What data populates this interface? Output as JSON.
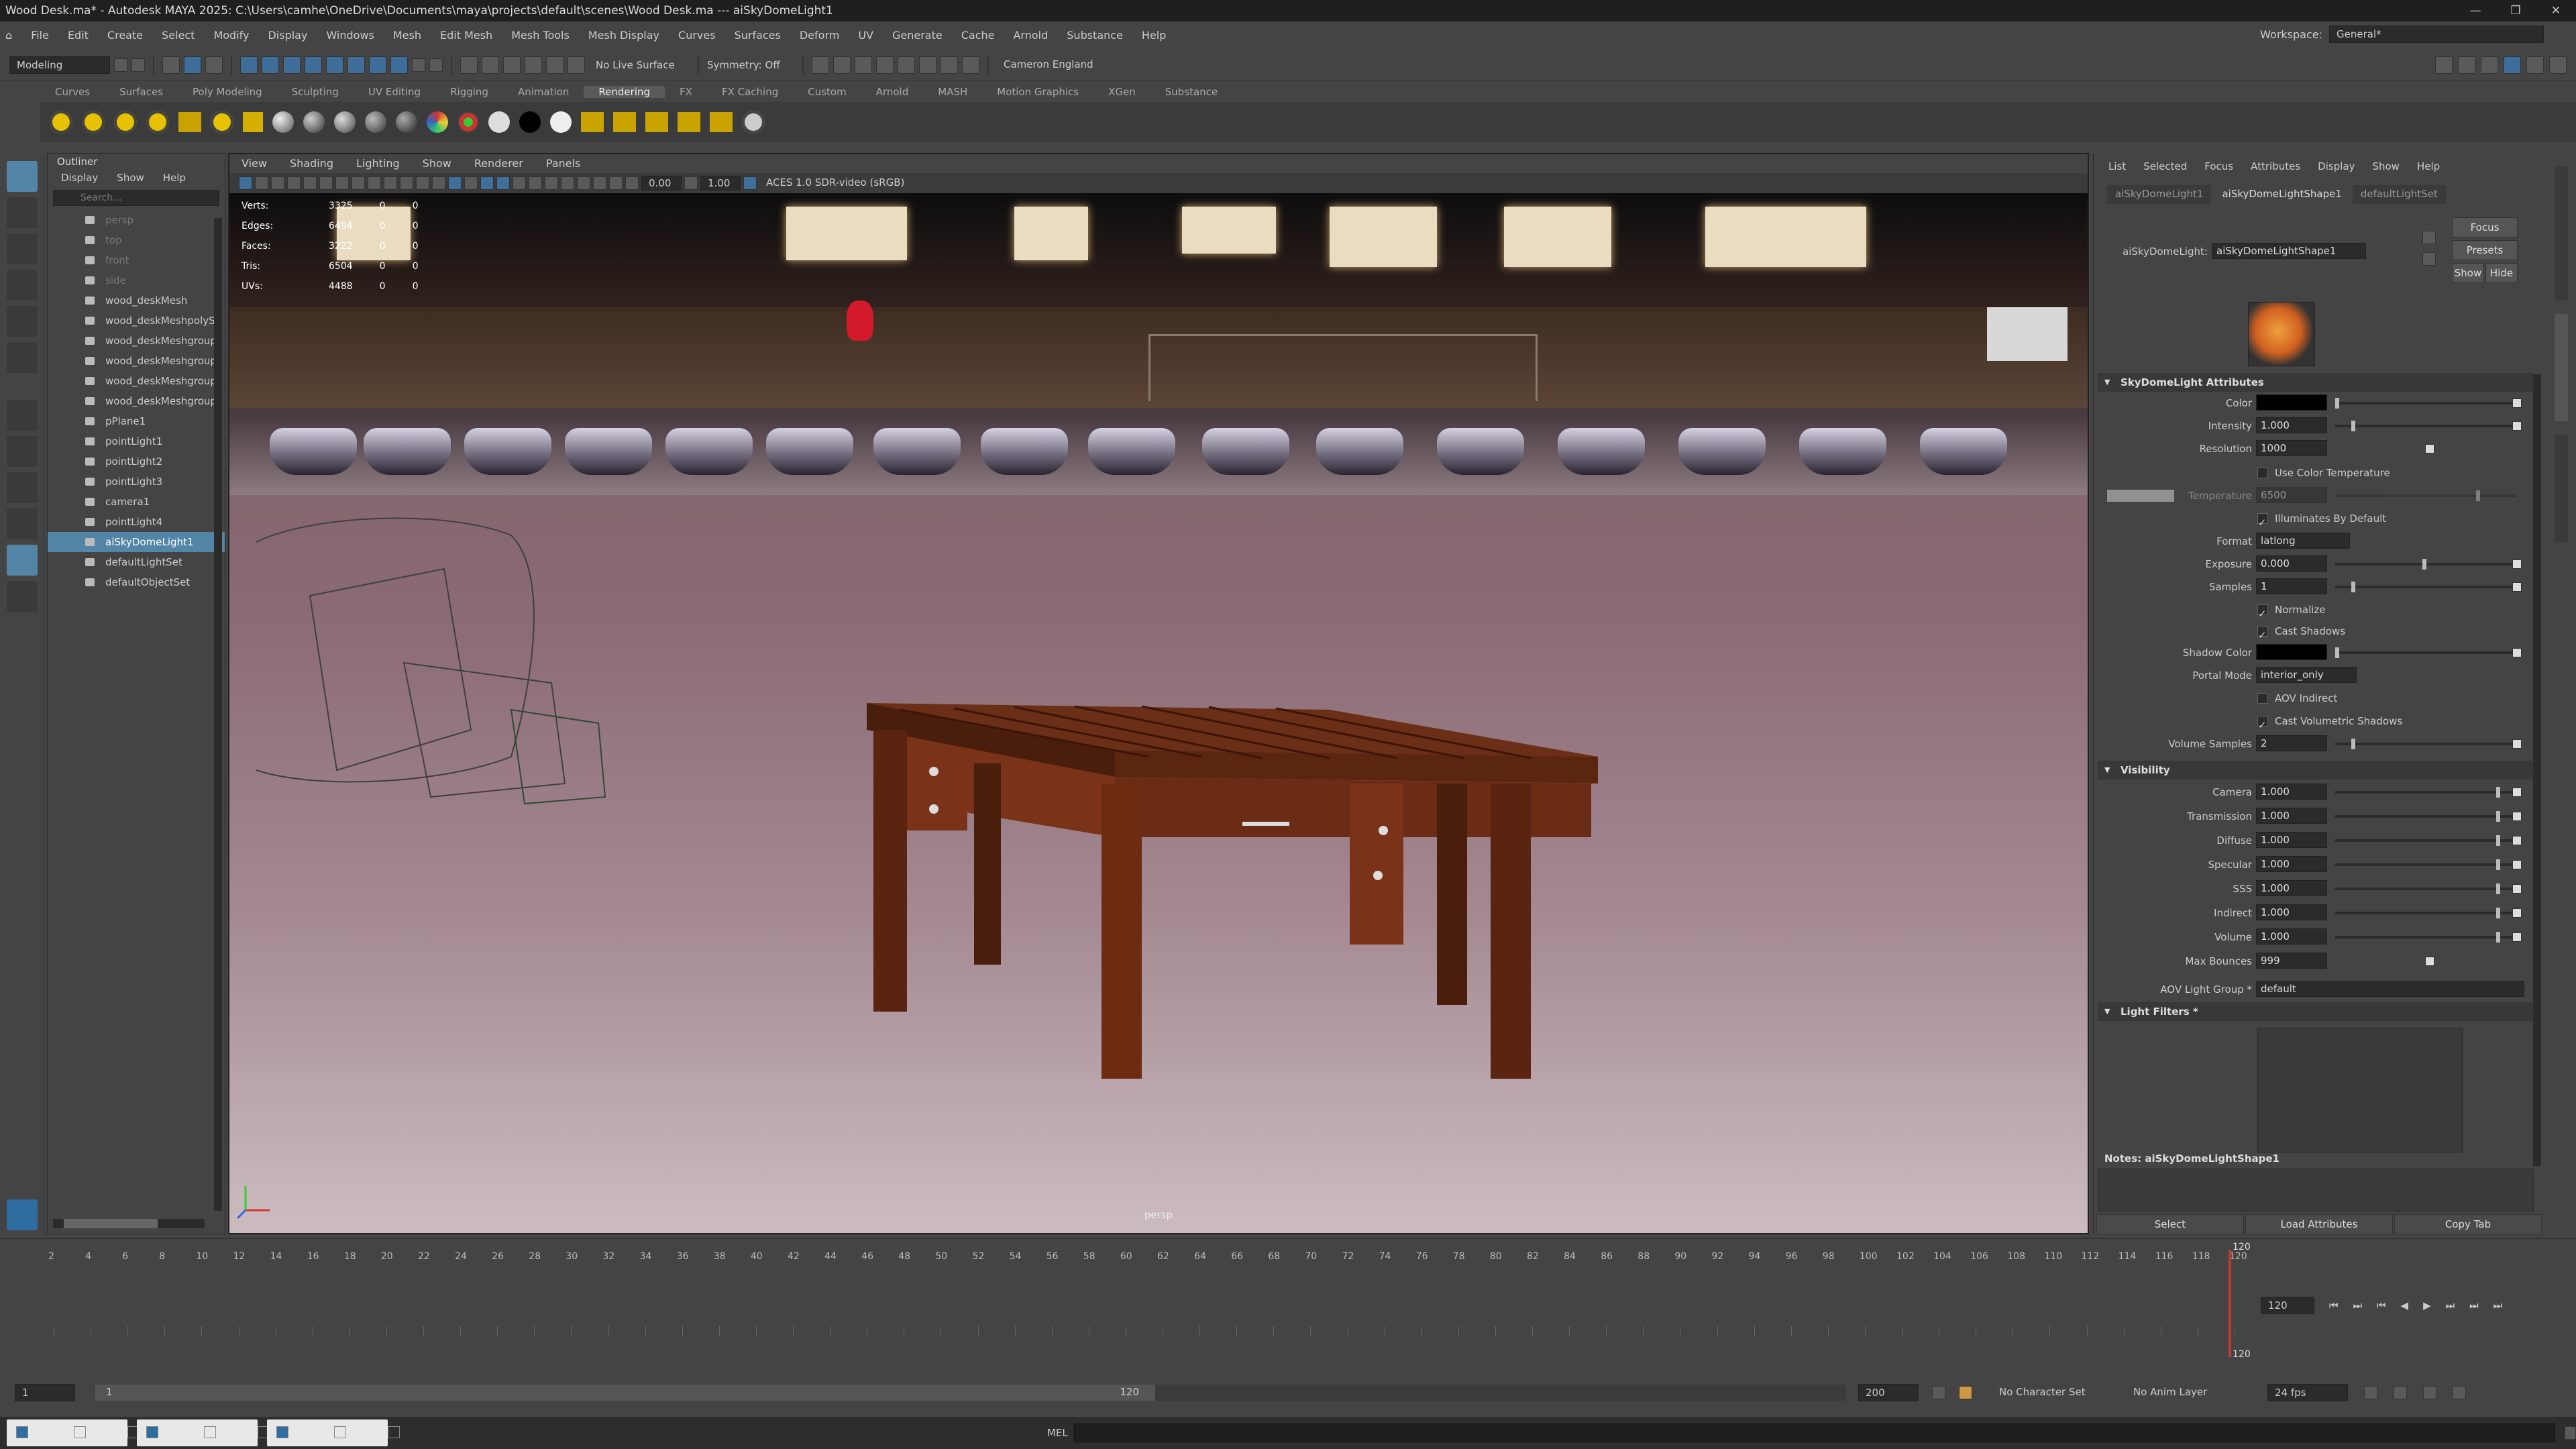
{
  "titlebar": {
    "text": "Wood Desk.ma* - Autodesk MAYA 2025: C:\\Users\\camhe\\OneDrive\\Documents\\maya\\projects\\default\\scenes\\Wood Desk.ma    ---    aiSkyDomeLight1"
  },
  "menubar": {
    "items": [
      "File",
      "Edit",
      "Create",
      "Select",
      "Modify",
      "Display",
      "Windows",
      "Mesh",
      "Edit Mesh",
      "Mesh Tools",
      "Mesh Display",
      "Curves",
      "Surfaces",
      "Deform",
      "UV",
      "Generate",
      "Cache",
      "Arnold",
      "Substance",
      "Help"
    ],
    "workspace_label": "Workspace:",
    "workspace_value": "General*"
  },
  "statusline": {
    "mode": "Modeling",
    "live_surface": "No Live Surface",
    "symmetry": "Symmetry: Off",
    "user": "Cameron England"
  },
  "shelf": {
    "tabs": [
      "Curves",
      "Surfaces",
      "Poly Modeling",
      "Sculpting",
      "UV Editing",
      "Rigging",
      "Animation",
      "Rendering",
      "FX",
      "FX Caching",
      "Custom",
      "Arnold",
      "MASH",
      "Motion Graphics",
      "XGen",
      "Substance"
    ],
    "active": "Rendering"
  },
  "outliner": {
    "title": "Outliner",
    "menu": [
      "Display",
      "Show",
      "Help"
    ],
    "search_placeholder": "Search...",
    "items": [
      "persp",
      "top",
      "front",
      "side",
      "wood_deskMesh",
      "wood_deskMeshpolyS",
      "wood_deskMeshgroup",
      "wood_deskMeshgroup",
      "wood_deskMeshgroup",
      "wood_deskMeshgroup",
      "pPlane1",
      "pointLight1",
      "pointLight2",
      "pointLight3",
      "camera1",
      "pointLight4",
      "aiSkyDomeLight1",
      "defaultLightSet",
      "defaultObjectSet"
    ],
    "selected": "aiSkyDomeLight1"
  },
  "viewport": {
    "menu": [
      "View",
      "Shading",
      "Lighting",
      "Show",
      "Renderer",
      "Panels"
    ],
    "value_a": "0.00",
    "value_b": "1.00",
    "colorspace": "ACES 1.0 SDR-video (sRGB)",
    "camera_label": "persp",
    "hud": [
      {
        "label": "Verts:",
        "v1": "3325",
        "v2": "0",
        "v3": "0"
      },
      {
        "label": "Edges:",
        "v1": "6494",
        "v2": "0",
        "v3": "0"
      },
      {
        "label": "Faces:",
        "v1": "3222",
        "v2": "0",
        "v3": "0"
      },
      {
        "label": "Tris:",
        "v1": "6504",
        "v2": "0",
        "v3": "0"
      },
      {
        "label": "UVs:",
        "v1": "4488",
        "v2": "0",
        "v3": "0"
      }
    ]
  },
  "attribute_editor": {
    "menu": [
      "List",
      "Selected",
      "Focus",
      "Attributes",
      "Display",
      "Show",
      "Help"
    ],
    "tabs": [
      "aiSkyDomeLight1",
      "aiSkyDomeLightShape1",
      "defaultLightSet"
    ],
    "active_tab": "aiSkyDomeLightShape1",
    "node_label": "aiSkyDomeLight:",
    "node_value": "aiSkyDomeLightShape1",
    "buttons": {
      "focus": "Focus",
      "presets": "Presets",
      "show": "Show",
      "hide": "Hide"
    },
    "section_sky": "SkyDomeLight Attributes",
    "color_label": "Color",
    "intensity_label": "Intensity",
    "intensity": "1.000",
    "resolution_label": "Resolution",
    "resolution": "1000",
    "use_color_temp": "Use Color Temperature",
    "temperature_label": "Temperature",
    "temperature": "6500",
    "illum_default": "Illuminates By Default",
    "format_label": "Format",
    "format": "latlong",
    "exposure_label": "Exposure",
    "exposure": "0.000",
    "samples_label": "Samples",
    "samples": "1",
    "normalize": "Normalize",
    "cast_shadows": "Cast Shadows",
    "shadow_color_label": "Shadow Color",
    "portal_label": "Portal Mode",
    "portal": "interior_only",
    "aov_indirect": "AOV Indirect",
    "cast_vol": "Cast Volumetric Shadows",
    "vol_samples_label": "Volume Samples",
    "vol_samples": "2",
    "section_vis": "Visibility",
    "visibility": [
      {
        "label": "Camera",
        "value": "1.000"
      },
      {
        "label": "Transmission",
        "value": "1.000"
      },
      {
        "label": "Diffuse",
        "value": "1.000"
      },
      {
        "label": "Specular",
        "value": "1.000"
      },
      {
        "label": "SSS",
        "value": "1.000"
      },
      {
        "label": "Indirect",
        "value": "1.000"
      },
      {
        "label": "Volume",
        "value": "1.000"
      }
    ],
    "max_bounces_label": "Max Bounces",
    "max_bounces": "999",
    "aov_group_label": "AOV Light Group *",
    "aov_group": "default",
    "section_filters": "Light Filters *",
    "notes": "Notes:  aiSkyDomeLightShape1",
    "bottom": {
      "select": "Select",
      "load": "Load Attributes",
      "copy": "Copy Tab"
    }
  },
  "timeline": {
    "frames": [
      "2",
      "4",
      "6",
      "8",
      "10",
      "12",
      "14",
      "16",
      "18",
      "20",
      "22",
      "24",
      "26",
      "28",
      "30",
      "32",
      "34",
      "36",
      "38",
      "40",
      "42",
      "44",
      "46",
      "48",
      "50",
      "52",
      "54",
      "56",
      "58",
      "60",
      "62",
      "64",
      "66",
      "68",
      "70",
      "72",
      "74",
      "76",
      "78",
      "80",
      "82",
      "84",
      "86",
      "88",
      "90",
      "92",
      "94",
      "96",
      "98",
      "100",
      "102",
      "104",
      "106",
      "108",
      "110",
      "112",
      "114",
      "116",
      "118",
      "120"
    ],
    "current_frame": "120",
    "current_time_field": "120"
  },
  "rangeslider": {
    "start": "1",
    "range_start": "1",
    "range_end": "120",
    "end": "200",
    "char_set": "No Character Set",
    "anim_layer": "No Anim Layer",
    "fps": "24 fps"
  },
  "cmdline": {
    "label": "MEL"
  },
  "colors": {
    "accent": "#5285a6",
    "bg": "#444444",
    "field": "#2b2b2b"
  }
}
